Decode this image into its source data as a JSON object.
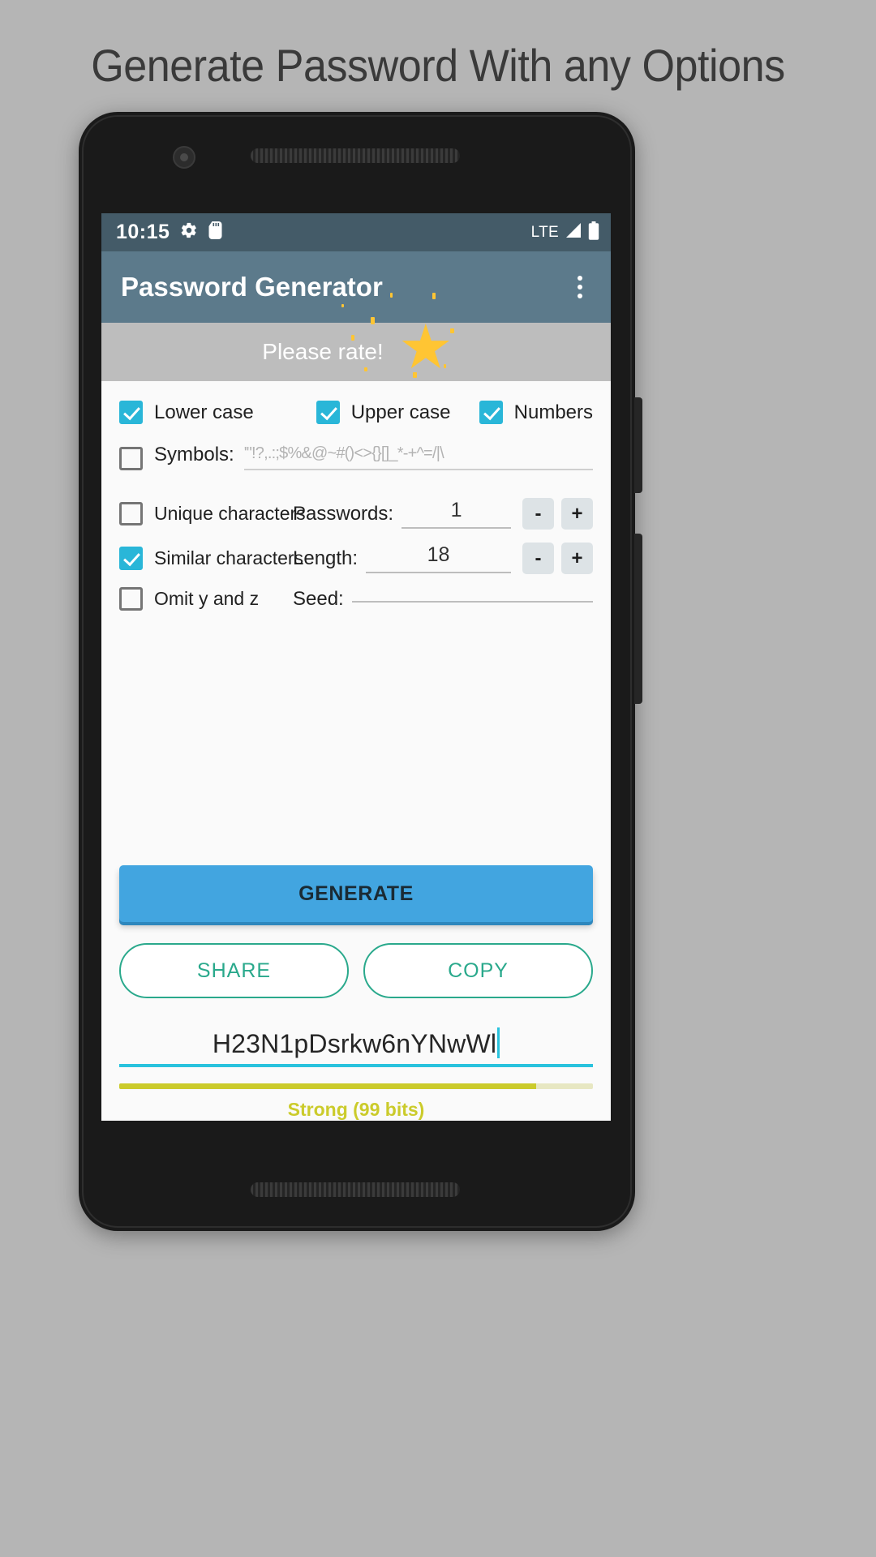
{
  "promo": {
    "headline": "Generate Password With any Options"
  },
  "phone": {
    "status_bar": {
      "time": "10:15",
      "icons": [
        "gear-icon",
        "sd-card-icon"
      ],
      "network_label": "LTE",
      "right_icons": [
        "signal-icon",
        "battery-icon"
      ],
      "background_color": "#445b68"
    },
    "app_bar": {
      "title": "Password Generator",
      "overflow_menu_label": "More options",
      "background_color": "#5c7a8b"
    },
    "rate_banner": {
      "text": "Please rate!",
      "star_icon": "star-icon",
      "background_color": "#bdbdbd"
    },
    "options": {
      "char_classes": [
        {
          "label": "Lower case",
          "checked": true
        },
        {
          "label": "Upper case",
          "checked": true
        },
        {
          "label": "Numbers",
          "checked": true
        }
      ],
      "symbols": {
        "label": "Symbols:",
        "checked": false,
        "value": "'\"!?,.:;$%&@~#()<>{}[]_*-+^=/|\\"
      },
      "rows": [
        {
          "checkbox_label": "Unique characters",
          "checked": false,
          "field_label": "Passwords:",
          "field_value": "1",
          "has_steppers": true,
          "minus_label": "-",
          "plus_label": "+"
        },
        {
          "checkbox_label": "Similar characters",
          "checked": true,
          "field_label": "Length:",
          "field_value": "18",
          "has_steppers": true,
          "minus_label": "-",
          "plus_label": "+"
        },
        {
          "checkbox_label": "Omit y and z",
          "checked": false,
          "field_label": "Seed:",
          "field_value": "",
          "has_steppers": false,
          "minus_label": "-",
          "plus_label": "+"
        }
      ]
    },
    "actions": {
      "generate_label": "GENERATE",
      "share_label": "SHARE",
      "copy_label": "COPY",
      "generate_color": "#42a5e0",
      "outline_color": "#2aa98c"
    },
    "result": {
      "password": "H23N1pDsrkw6nYNwWl",
      "caret_color": "#29c2dd",
      "strength_label": "Strong (99 bits)",
      "strength_percent": 88,
      "strength_color": "#cbcb2b"
    }
  }
}
